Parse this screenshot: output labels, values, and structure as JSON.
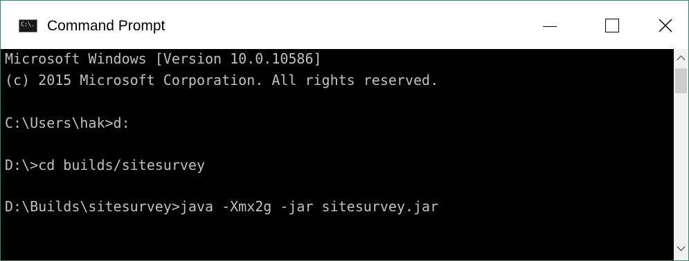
{
  "window": {
    "title": "Command Prompt",
    "icon": "cmd-icon",
    "icon_glyph": "C:\\.",
    "buttons": {
      "minimize": "minimize-icon",
      "maximize": "maximize-icon",
      "close": "close-icon"
    }
  },
  "console": {
    "lines": [
      "Microsoft Windows [Version 10.0.10586]",
      "(c) 2015 Microsoft Corporation. All rights reserved.",
      "",
      "C:\\Users\\hak>d:",
      "",
      "D:\\>cd builds/sitesurvey",
      "",
      "D:\\Builds\\sitesurvey>java -Xmx2g -jar sitesurvey.jar"
    ]
  },
  "colors": {
    "console_bg": "#000000",
    "console_text": "#c0c0c0",
    "window_border": "#2b8a6a"
  }
}
